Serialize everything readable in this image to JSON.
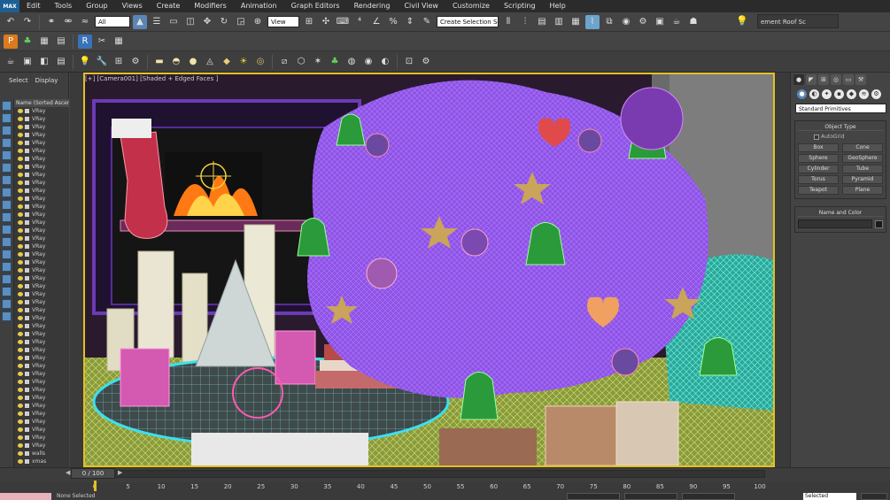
{
  "menu": {
    "logo": "MAX",
    "items": [
      "Edit",
      "Tools",
      "Group",
      "Views",
      "Create",
      "Modifiers",
      "Animation",
      "Graph Editors",
      "Rendering",
      "Civil View",
      "Customize",
      "Scripting",
      "Help"
    ]
  },
  "toolbar_main": {
    "selection_filter": "All",
    "ref_coord": "View",
    "selection_set": "Create Selection Se",
    "workspace_field": "ement Roof Sc"
  },
  "explorer": {
    "tab_select": "Select",
    "tab_display": "Display",
    "column_header": "Name (Sorted Ascen",
    "rows": [
      "VRay",
      "VRay",
      "VRay",
      "VRay",
      "VRay",
      "VRay",
      "VRay",
      "VRay",
      "VRay",
      "VRay",
      "VRay",
      "VRay",
      "VRay",
      "VRay",
      "VRay",
      "VRay",
      "VRay",
      "VRay",
      "VRay",
      "VRay",
      "VRay",
      "VRay",
      "VRay",
      "VRay",
      "VRay",
      "VRay",
      "VRay",
      "VRay",
      "VRay",
      "VRay",
      "VRay",
      "VRay",
      "VRay",
      "VRay",
      "VRay",
      "VRay",
      "VRay",
      "VRay",
      "VRay",
      "VRay",
      "VRay",
      "VRay",
      "VRay",
      "walls",
      "xmas"
    ]
  },
  "viewport": {
    "label": "[+] [Camera001] [Shaded + Edged Faces ]"
  },
  "command_panel": {
    "dropdown": "Standard Primitives",
    "object_type_title": "Object Type",
    "autogrid_label": "AutoGrid",
    "primitives": [
      "Box",
      "Cone",
      "Sphere",
      "GeoSphere",
      "Cylinder",
      "Tube",
      "Torus",
      "Pyramid",
      "Teapot",
      "Plane"
    ],
    "name_color_title": "Name and Color"
  },
  "timeline": {
    "frame_display": "0 / 100",
    "ticks": [
      "0",
      "5",
      "10",
      "15",
      "20",
      "25",
      "30",
      "35",
      "40",
      "45",
      "50",
      "55",
      "60",
      "65",
      "70",
      "75",
      "80",
      "85",
      "90",
      "95",
      "100"
    ]
  },
  "status": {
    "selection_text": "None Selected",
    "right_dropdown": "Selected"
  },
  "colors": {
    "viewport_border": "#e4c022",
    "tree_wire": "#9b5cf2",
    "status_swatch": "#e7b2ba"
  }
}
